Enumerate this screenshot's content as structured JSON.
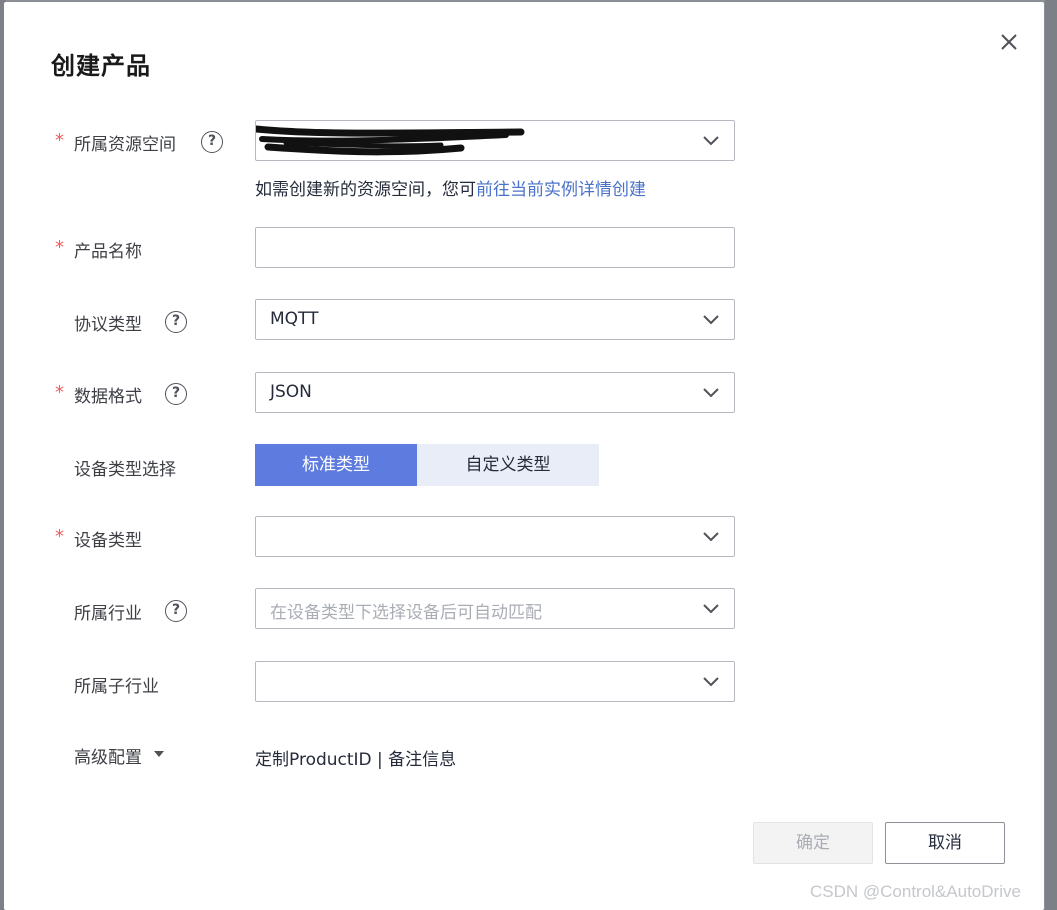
{
  "dialog": {
    "title": "创建产品",
    "close_icon": "close-icon"
  },
  "form": {
    "resource_space": {
      "label": "所属资源空间",
      "required": true,
      "value": "",
      "value_redacted": true,
      "hint_prefix": "如需创建新的资源空间，您可",
      "hint_link": "前往当前实例详情创建"
    },
    "product_name": {
      "label": "产品名称",
      "required": true,
      "value": ""
    },
    "protocol_type": {
      "label": "协议类型",
      "required": false,
      "value": "MQTT"
    },
    "data_format": {
      "label": "数据格式",
      "required": true,
      "value": "JSON"
    },
    "device_type_selection": {
      "label": "设备类型选择",
      "options": [
        "标准类型",
        "自定义类型"
      ],
      "selected": "标准类型"
    },
    "device_type": {
      "label": "设备类型",
      "required": true,
      "value": ""
    },
    "industry": {
      "label": "所属行业",
      "required": false,
      "value": "",
      "placeholder": "在设备类型下选择设备后可自动匹配"
    },
    "sub_industry": {
      "label": "所属子行业",
      "required": false,
      "value": ""
    },
    "advanced": {
      "label": "高级配置",
      "summary": "定制ProductID | 备注信息"
    }
  },
  "footer": {
    "confirm_label": "确定",
    "cancel_label": "取消",
    "confirm_disabled": true
  },
  "watermark": "CSDN @Control&AutoDrive",
  "colors": {
    "primary": "#5e7ce0",
    "required": "#f05b5b",
    "link": "#4a72c9",
    "border": "#b6b9bf"
  }
}
